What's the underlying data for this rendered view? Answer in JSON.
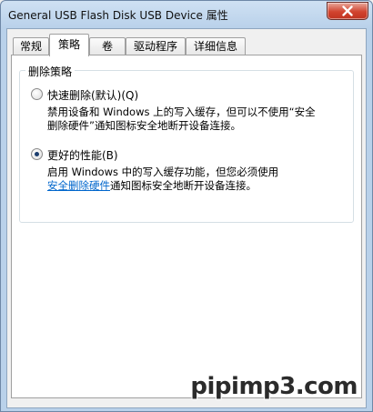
{
  "window": {
    "title": "General USB Flash Disk USB Device 属性"
  },
  "tabs": [
    {
      "label": "常规"
    },
    {
      "label": "策略"
    },
    {
      "label": "卷"
    },
    {
      "label": "驱动程序"
    },
    {
      "label": "详细信息"
    }
  ],
  "active_tab": "策略",
  "group": {
    "title": "删除策略",
    "options": [
      {
        "label": "快速删除(默认)(Q)",
        "checked": false,
        "description_line1": "禁用设备和 Windows 上的写入缓存，但可以不使用“安全",
        "description_line2": "删除硬件”通知图标安全地断开设备连接。"
      },
      {
        "label": "更好的性能(B)",
        "checked": true,
        "description_line1": "启用 Windows 中的写入缓存功能，但您必须使用",
        "description_link": "安全删除硬件",
        "description_line2_rest": "通知图标安全地断开设备连接。"
      }
    ]
  },
  "watermark": "pipimp3.com",
  "icons": {
    "close": "close-icon",
    "radio": "radio-button"
  }
}
